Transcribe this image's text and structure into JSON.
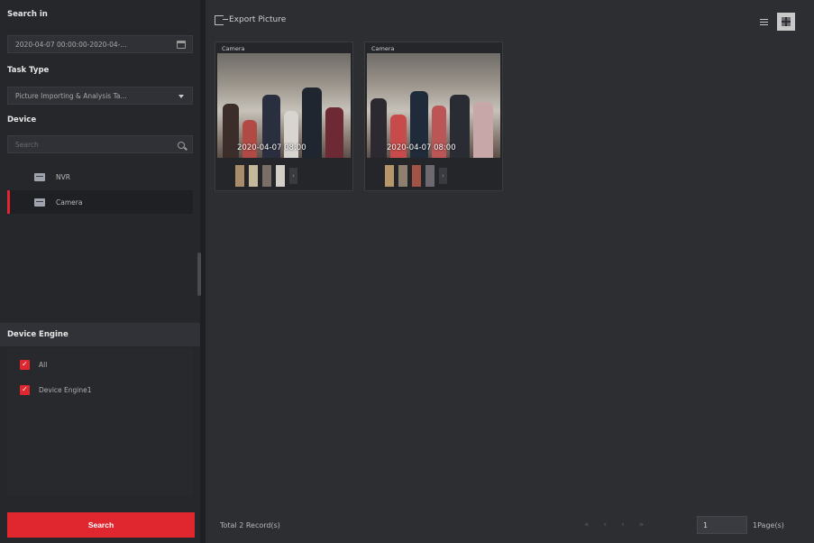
{
  "sidebar": {
    "search_in_label": "Search in",
    "time_range_value": "2020-04-07 00:00:00-2020-04-...",
    "task_type_label": "Task Type",
    "task_type_value": "Picture Importing & Analysis Ta...",
    "device_label": "Device",
    "device_search_placeholder": "Search",
    "devices": [
      {
        "label": "NVR",
        "selected": false
      },
      {
        "label": "Camera",
        "selected": true
      }
    ],
    "engine_label": "Device Engine",
    "engine_options": [
      {
        "label": "All",
        "checked": true
      },
      {
        "label": "Device Engine1",
        "checked": true
      }
    ],
    "search_button": "Search"
  },
  "main": {
    "export_label": "Export Picture",
    "view_modes": [
      "list",
      "grid"
    ],
    "active_view": "grid",
    "cards": [
      {
        "camera": "Camera",
        "timestamp": "2020-04-07 08:00"
      },
      {
        "camera": "Camera",
        "timestamp": "2020-04-07 08:00"
      }
    ],
    "total_records": "Total 2 Record(s)",
    "pager_controls": [
      "«",
      "‹",
      "›",
      "»"
    ],
    "current_page": "1",
    "page_count": "1Page(s)"
  },
  "colors": {
    "accent": "#e0262f",
    "sidebar_bg": "#26272b",
    "main_bg": "#2d2e32"
  },
  "icons": {
    "time_field": "calendar-icon",
    "task_field": "caret-down-icon",
    "device_search": "search-icon",
    "device": "device-icon",
    "export": "export-icon",
    "view_list": "list-view-icon",
    "view_grid": "grid-view-icon"
  }
}
